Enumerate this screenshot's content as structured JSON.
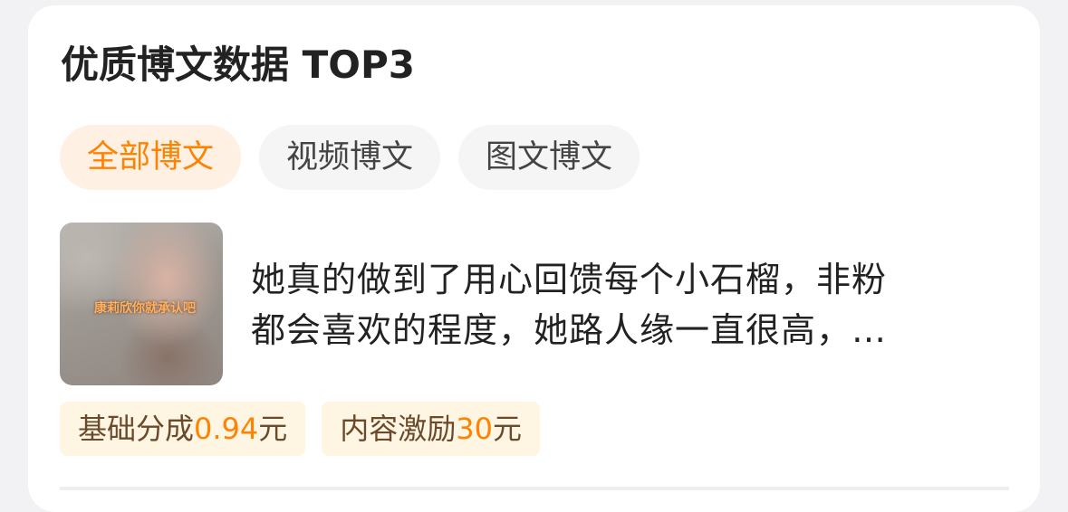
{
  "card": {
    "title": "优质博文数据 TOP3"
  },
  "tabs": [
    {
      "label": "全部博文",
      "active": true
    },
    {
      "label": "视频博文",
      "active": false
    },
    {
      "label": "图文博文",
      "active": false
    }
  ],
  "post": {
    "thumbnail_caption": "康莉欣你就承认吧",
    "text_line1": "她真的做到了用心回馈每个小石榴，非粉",
    "text_line2": "都会喜欢的程度，她路人缘一直很高，…",
    "badges": [
      {
        "label": "基础分成",
        "value": "0.94",
        "unit": "元"
      },
      {
        "label": "内容激励",
        "value": "30",
        "unit": "元"
      }
    ]
  },
  "colors": {
    "accent": "#ff8200",
    "active_tab_bg": "#fff0e4",
    "badge_bg": "#fff5e3"
  }
}
